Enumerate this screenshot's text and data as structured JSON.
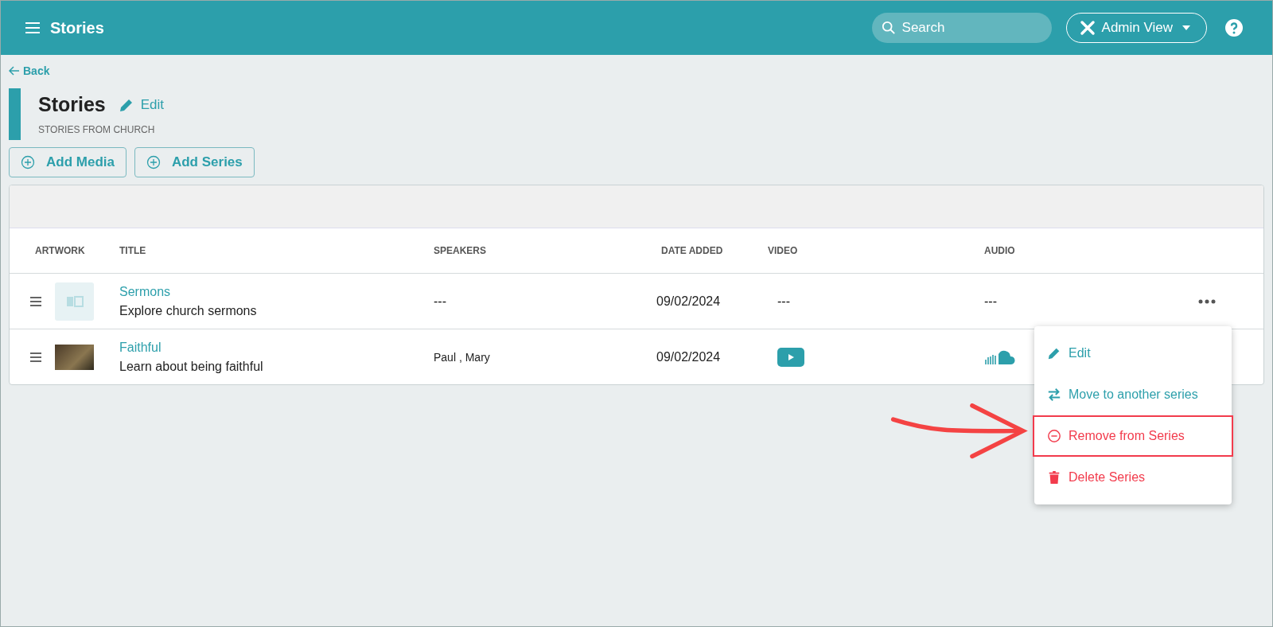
{
  "header": {
    "title": "Stories",
    "search_placeholder": "Search",
    "view_button": "Admin View"
  },
  "back": "Back",
  "page": {
    "title": "Stories",
    "edit": "Edit",
    "subtitle": "STORIES FROM CHURCH"
  },
  "actions": [
    "Add Media",
    "Add Series"
  ],
  "table": {
    "columns": [
      "ARTWORK",
      "TITLE",
      "SPEAKERS",
      "DATE ADDED",
      "VIDEO",
      "AUDIO"
    ],
    "rows": [
      {
        "artwork": {
          "kind": "placeholder"
        },
        "title": "Sermons",
        "description": "Explore church sermons",
        "speakers": "---",
        "date": "09/02/2024",
        "video": {
          "kind": "dash",
          "text": "---"
        },
        "audio": {
          "kind": "dash",
          "text": "---"
        },
        "more_button": true
      },
      {
        "artwork": {
          "kind": "photo"
        },
        "title": "Faithful",
        "description": "Learn about being faithful",
        "speakers": "Paul , Mary",
        "date": "09/02/2024",
        "video": {
          "kind": "play"
        },
        "audio": {
          "kind": "cloud"
        }
      }
    ]
  },
  "menu": [
    {
      "kind": "edit",
      "label": "Edit",
      "danger": false,
      "highlighted": false
    },
    {
      "kind": "move",
      "label": "Move to another series",
      "danger": false,
      "highlighted": false
    },
    {
      "kind": "remove",
      "label": "Remove from Series",
      "danger": true,
      "highlighted": true
    },
    {
      "kind": "delete",
      "label": "Delete Series",
      "danger": true,
      "highlighted": false
    }
  ]
}
